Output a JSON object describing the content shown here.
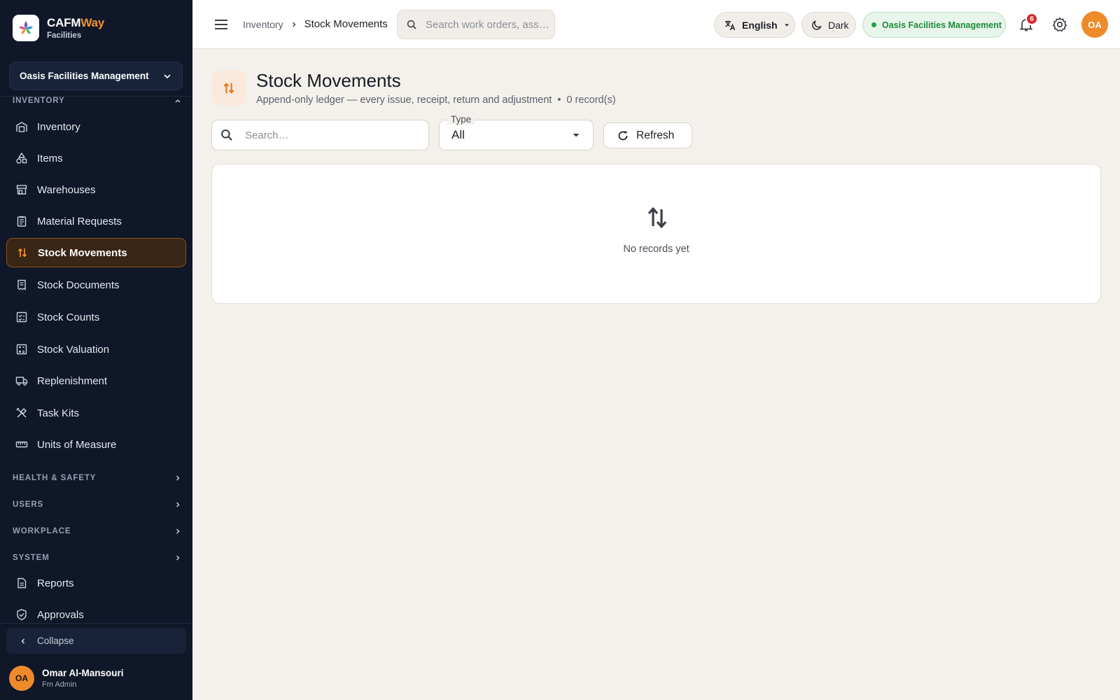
{
  "brand": {
    "name_part1": "CAFM",
    "name_part2": "Way",
    "subtitle": "Facilities"
  },
  "org_select": {
    "value": "Oasis Facilities Management"
  },
  "sidebar": {
    "inventory_section": "INVENTORY",
    "items": [
      {
        "label": "Inventory",
        "icon": "warehouse-icon"
      },
      {
        "label": "Items",
        "icon": "shapes-icon"
      },
      {
        "label": "Warehouses",
        "icon": "store-icon"
      },
      {
        "label": "Material Requests",
        "icon": "clipboard-icon"
      },
      {
        "label": "Stock Movements",
        "icon": "swap-vertical-icon",
        "active": true
      },
      {
        "label": "Stock Documents",
        "icon": "receipt-icon"
      },
      {
        "label": "Stock Counts",
        "icon": "checklist-icon"
      },
      {
        "label": "Stock Valuation",
        "icon": "calculator-icon"
      },
      {
        "label": "Replenishment",
        "icon": "truck-icon"
      },
      {
        "label": "Task Kits",
        "icon": "tools-icon"
      },
      {
        "label": "Units of Measure",
        "icon": "ruler-icon"
      }
    ],
    "sections": [
      "HEALTH & SAFETY",
      "USERS",
      "WORKPLACE",
      "SYSTEM"
    ],
    "extra_items": [
      {
        "label": "Reports",
        "icon": "report-icon"
      },
      {
        "label": "Approvals",
        "icon": "shield-check-icon"
      }
    ],
    "collapse_label": "Collapse",
    "user": {
      "initials": "OA",
      "name": "Omar Al-Mansouri",
      "role": "Fm Admin"
    }
  },
  "topbar": {
    "breadcrumb_parent": "Inventory",
    "breadcrumb_current": "Stock Movements",
    "search_placeholder": "Search work orders, ass…",
    "language": "English",
    "theme": "Dark",
    "org_status": "Oasis Facilities Management",
    "notification_count": "6",
    "user_initials": "OA"
  },
  "page": {
    "title": "Stock Movements",
    "subtitle": "Append-only ledger — every issue, receipt, return and adjustment",
    "bullet": "•",
    "record_count": "0 record(s)",
    "search_placeholder": "Search…",
    "type_label": "Type",
    "type_value": "All",
    "refresh_label": "Refresh",
    "empty_text": "No records yet"
  },
  "colors": {
    "accent": "#ef8a2b",
    "sidebar_bg": "#0f1729",
    "status_green": "#1fa24a",
    "badge_red": "#d82a2a"
  }
}
